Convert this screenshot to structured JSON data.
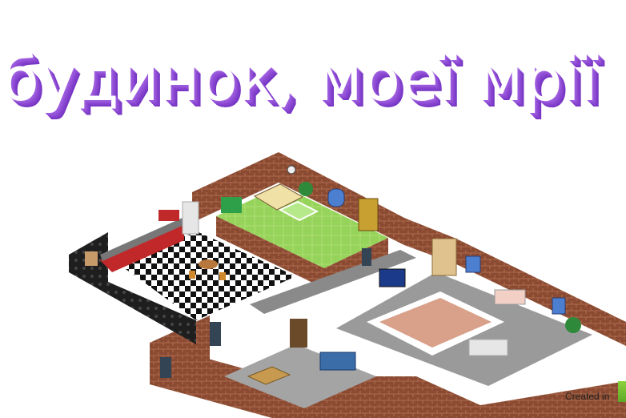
{
  "title": "будинок, моеї мрії",
  "footer": {
    "credit": "Created in"
  },
  "colors": {
    "title_fill": "#ffffff",
    "title_shadow": "#8a4ad2",
    "brick": "#8b4b32",
    "bedroom_floor": "#98d35b",
    "kitchen_floor": "#1b1b1b",
    "living_floor": "#9a9a9a",
    "rug": "#d9a08a"
  }
}
